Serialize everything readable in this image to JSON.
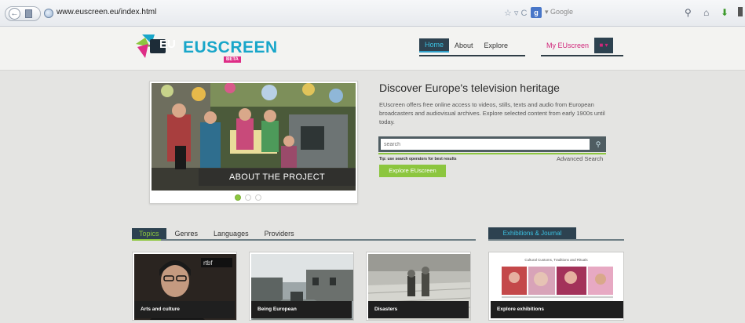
{
  "browser": {
    "url": "www.euscreen.eu/index.html",
    "search_engine_label": "Google",
    "search_engine_icon": "g-icon",
    "toolbar_symbols": "☆ ▿ C"
  },
  "header": {
    "logo_text": "EUSCREEN",
    "logo_beta": "BETA",
    "nav": [
      {
        "label": "Home",
        "active": true
      },
      {
        "label": "About",
        "active": false
      },
      {
        "label": "Explore",
        "active": false
      }
    ],
    "my_account": "My EUscreen"
  },
  "hero": {
    "caption": "ABOUT THE PROJECT",
    "slides": 3,
    "active_slide": 1
  },
  "intro": {
    "title": "Discover Europe's television heritage",
    "text": "EUscreen offers free online access to videos, stills, texts and audio from European broadcasters and audiovisual archives. Explore selected content from early 1900s until today.",
    "search_placeholder": "search",
    "tip": "Tip: use search operators for best results",
    "advanced_search": "Advanced Search",
    "explore_button": "Explore EUscreen"
  },
  "tabs": [
    {
      "label": "Topics",
      "active": true
    },
    {
      "label": "Genres",
      "active": false
    },
    {
      "label": "Languages",
      "active": false
    },
    {
      "label": "Providers",
      "active": false
    }
  ],
  "exhibitions_tab": "Exhibitions & Journal",
  "cards": [
    {
      "label": "Arts and culture"
    },
    {
      "label": "Being European"
    },
    {
      "label": "Disasters"
    }
  ],
  "exhibition_card": {
    "doc_title": "Cultural Customs, Traditions and Rituals",
    "label": "Explore exhibitions"
  },
  "colors": {
    "accent_green": "#8cc63f",
    "accent_blue": "#18a6c9",
    "accent_pink": "#de2d86",
    "nav_dark": "#2d4250"
  }
}
